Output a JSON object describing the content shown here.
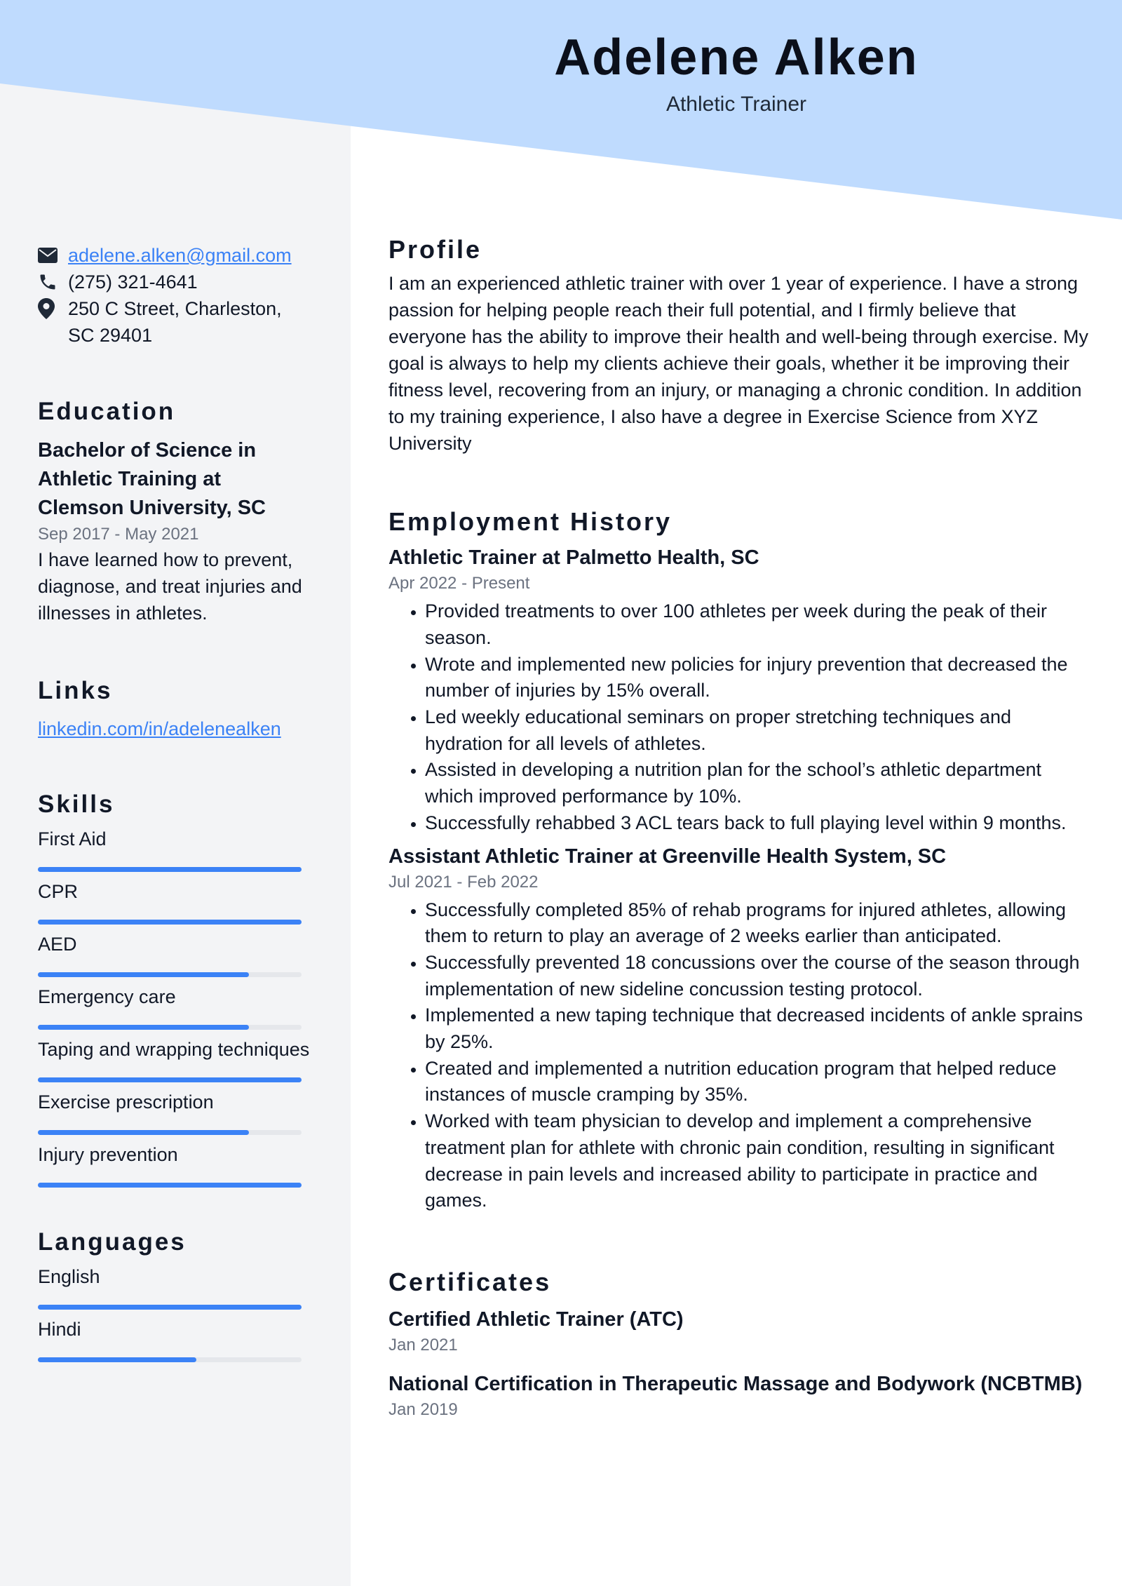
{
  "header": {
    "name": "Adelene Alken",
    "role": "Athletic Trainer"
  },
  "colors": {
    "header_bg": "#bfdbfe",
    "sidebar_bg": "#f3f4f6",
    "accent": "#3b82f6",
    "text": "#111827",
    "muted": "#6b7280"
  },
  "contact": {
    "email": "adelene.alken@gmail.com",
    "phone": "(275) 321-4641",
    "address": "250 C Street, Charleston, SC 29401",
    "icons": [
      "envelope-icon",
      "phone-icon",
      "location-pin-icon"
    ]
  },
  "education": {
    "heading": "Education",
    "degree": "Bachelor of Science in Athletic Training at Clemson University, SC",
    "dates": "Sep 2017 - May 2021",
    "description": "I have learned how to prevent, diagnose, and treat injuries and illnesses in athletes."
  },
  "links": {
    "heading": "Links",
    "items": [
      "linkedin.com/in/adelenealken"
    ]
  },
  "skills": {
    "heading": "Skills",
    "items": [
      {
        "label": "First Aid",
        "level": 1.0
      },
      {
        "label": "CPR",
        "level": 1.0
      },
      {
        "label": "AED",
        "level": 0.8
      },
      {
        "label": "Emergency care",
        "level": 0.8
      },
      {
        "label": "Taping and wrapping techniques",
        "level": 1.0
      },
      {
        "label": "Exercise prescription",
        "level": 0.8
      },
      {
        "label": "Injury prevention",
        "level": 1.0
      }
    ]
  },
  "languages": {
    "heading": "Languages",
    "items": [
      {
        "label": "English",
        "level": 1.0
      },
      {
        "label": "Hindi",
        "level": 0.6
      }
    ]
  },
  "profile": {
    "heading": "Profile",
    "text": "I am an experienced athletic trainer with over 1 year of experience. I have a strong passion for helping people reach their full potential, and I firmly believe that everyone has the ability to improve their health and well-being through exercise. My goal is always to help my clients achieve their goals, whether it be improving their fitness level, recovering from an injury, or managing a chronic condition. In addition to my training experience, I also have a degree in Exercise Science from XYZ University"
  },
  "employment": {
    "heading": "Employment History",
    "jobs": [
      {
        "title": "Athletic Trainer at Palmetto Health, SC",
        "dates": "Apr 2022 - Present",
        "bullets": [
          "Provided treatments to over 100 athletes per week during the peak of their season.",
          "Wrote and implemented new policies for injury prevention that decreased the number of injuries by 15% overall.",
          "Led weekly educational seminars on proper stretching techniques and hydration for all levels of athletes.",
          "Assisted in developing a nutrition plan for the school’s athletic department which improved performance by 10%.",
          "Successfully rehabbed 3 ACL tears back to full playing level within 9 months."
        ]
      },
      {
        "title": "Assistant Athletic Trainer at Greenville Health System, SC",
        "dates": "Jul 2021 - Feb 2022",
        "bullets": [
          "Successfully completed 85% of rehab programs for injured athletes, allowing them to return to play an average of 2 weeks earlier than anticipated.",
          "Successfully prevented 18 concussions over the course of the season through implementation of new sideline concussion testing protocol.",
          "Implemented a new taping technique that decreased incidents of ankle sprains by 25%.",
          "Created and implemented a nutrition education program that helped reduce instances of muscle cramping by 35%.",
          "Worked with team physician to develop and implement a comprehensive treatment plan for athlete with chronic pain condition, resulting in significant decrease in pain levels and increased ability to participate in practice and games."
        ]
      }
    ]
  },
  "certificates": {
    "heading": "Certificates",
    "items": [
      {
        "title": "Certified Athletic Trainer (ATC)",
        "date": "Jan 2021"
      },
      {
        "title": "National Certification in Therapeutic Massage and Bodywork (NCBTMB)",
        "date": "Jan 2019"
      }
    ]
  }
}
